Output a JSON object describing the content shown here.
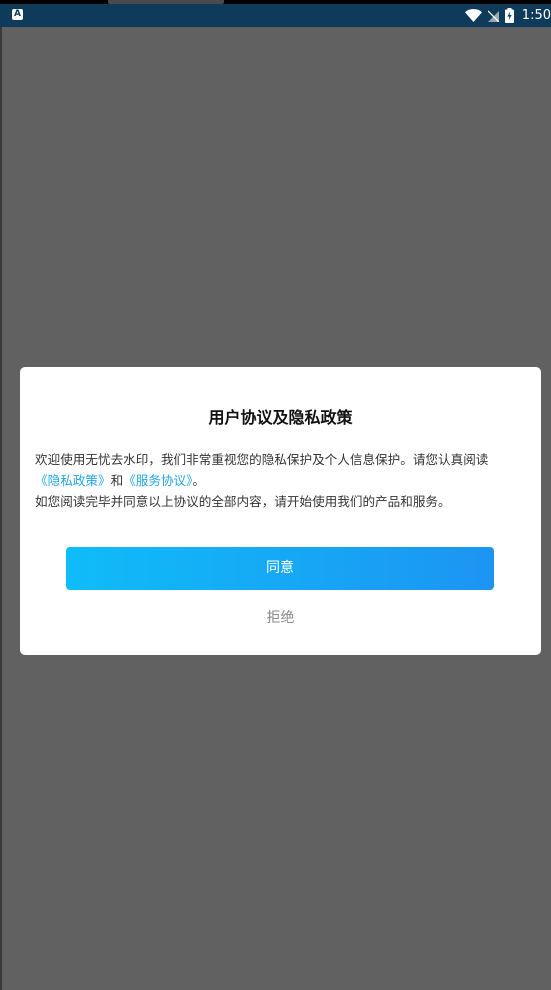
{
  "status_bar": {
    "app_icon_letter": "A",
    "time": "1:50"
  },
  "dialog": {
    "title": "用户协议及隐私政策",
    "body_line1": "欢迎使用无忧去水印，我们非常重视您的隐私保护及个人信息保护。请您认真阅读",
    "privacy_link": "《隐私政策》",
    "and_text": "和",
    "service_link": "《服务协议》",
    "period": "。",
    "body_line3": "如您阅读完毕并同意以上协议的全部内容，请开始使用我们的产品和服务。",
    "agree_label": "同意",
    "reject_label": "拒绝"
  },
  "colors": {
    "overlay": "#616161",
    "status_bar": "#0e3b5a",
    "link": "#22a6e9",
    "button_start": "#10bcf9",
    "button_end": "#1c95f2"
  }
}
